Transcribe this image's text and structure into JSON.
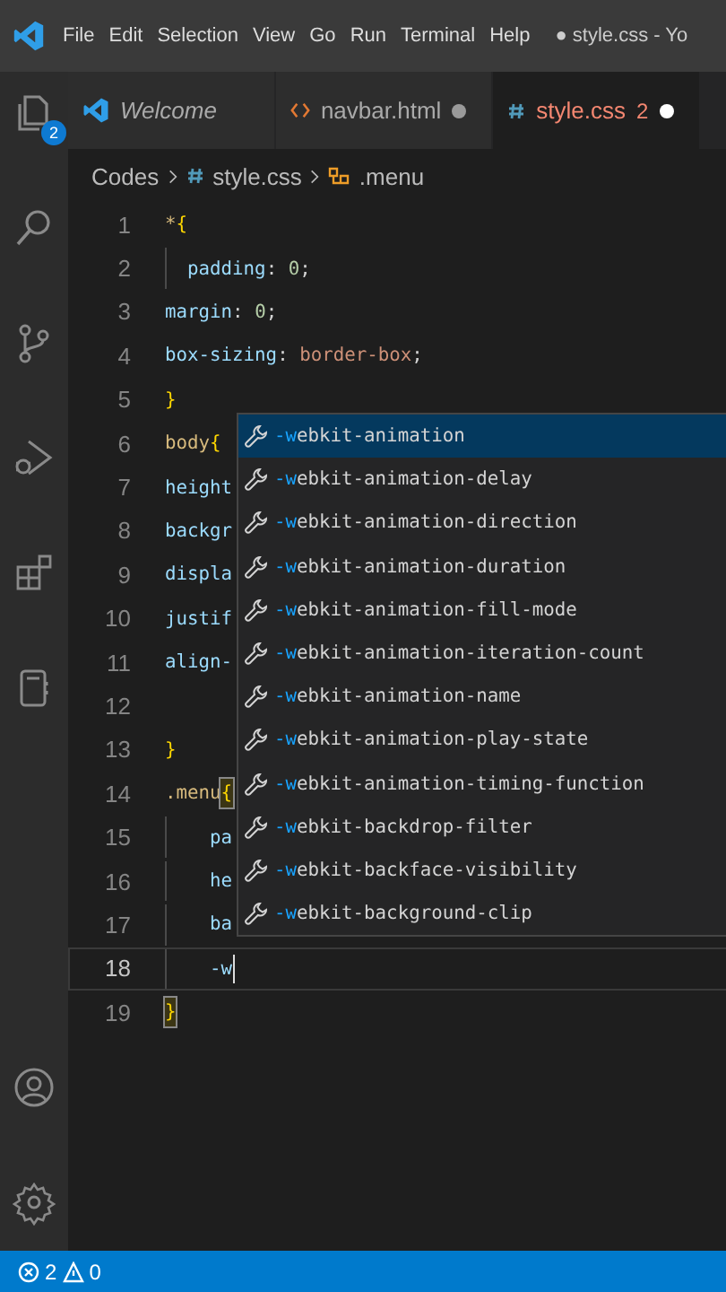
{
  "menu_bar": {
    "items": [
      "File",
      "Edit",
      "Selection",
      "View",
      "Go",
      "Run",
      "Terminal",
      "Help"
    ],
    "title": "● style.css - Yo"
  },
  "activity_bar": {
    "explorer_badge": "2"
  },
  "tabs": [
    {
      "label": "Welcome",
      "kind": "welcome",
      "selected": false,
      "dirty": false
    },
    {
      "label": "navbar.html",
      "kind": "html",
      "selected": false,
      "dirty": true
    },
    {
      "label": "style.css",
      "kind": "css",
      "selected": true,
      "problems": "2",
      "dirty": true
    }
  ],
  "breadcrumb": {
    "folder": "Codes",
    "file": "style.css",
    "symbol": ".menu"
  },
  "lines": [
    {
      "number": "1",
      "current": false,
      "tokens": [
        {
          "kind": "selector",
          "text": "*"
        },
        {
          "kind": "brace",
          "text": "{"
        }
      ]
    },
    {
      "number": "2",
      "current": false,
      "guide": true,
      "tokens": [
        {
          "kind": "property",
          "text": "  padding"
        },
        {
          "kind": "punct",
          "text": ": "
        },
        {
          "kind": "number",
          "text": "0"
        },
        {
          "kind": "punct",
          "text": ";"
        }
      ]
    },
    {
      "number": "3",
      "current": false,
      "tokens": [
        {
          "kind": "property",
          "text": "margin"
        },
        {
          "kind": "punct",
          "text": ": "
        },
        {
          "kind": "number",
          "text": "0"
        },
        {
          "kind": "punct",
          "text": ";"
        }
      ]
    },
    {
      "number": "4",
      "current": false,
      "tokens": [
        {
          "kind": "property",
          "text": "box-sizing"
        },
        {
          "kind": "punct",
          "text": ": "
        },
        {
          "kind": "string",
          "text": "border-box"
        },
        {
          "kind": "punct",
          "text": ";"
        }
      ]
    },
    {
      "number": "5",
      "current": false,
      "tokens": [
        {
          "kind": "brace",
          "text": "}"
        }
      ]
    },
    {
      "number": "6",
      "current": false,
      "tokens": [
        {
          "kind": "selector",
          "text": "body"
        },
        {
          "kind": "brace",
          "text": "{"
        }
      ]
    },
    {
      "number": "7",
      "current": false,
      "tokens": [
        {
          "kind": "property",
          "text": "height"
        }
      ]
    },
    {
      "number": "8",
      "current": false,
      "tokens": [
        {
          "kind": "property",
          "text": "backgr"
        }
      ]
    },
    {
      "number": "9",
      "current": false,
      "tokens": [
        {
          "kind": "property",
          "text": "displa"
        }
      ]
    },
    {
      "number": "10",
      "current": false,
      "tokens": [
        {
          "kind": "property",
          "text": "justif"
        }
      ]
    },
    {
      "number": "11",
      "current": false,
      "tokens": [
        {
          "kind": "property",
          "text": "align-"
        }
      ]
    },
    {
      "number": "12",
      "current": false
    },
    {
      "number": "13",
      "current": false,
      "tokens": [
        {
          "kind": "brace",
          "text": "}"
        }
      ]
    },
    {
      "number": "14",
      "current": false,
      "tokens": [
        {
          "kind": "selector",
          "text": ".menu"
        },
        {
          "kind": "brace-match",
          "text": "{"
        }
      ]
    },
    {
      "number": "15",
      "current": false,
      "guide": true,
      "tokens": [
        {
          "kind": "property",
          "text": "    pa"
        }
      ]
    },
    {
      "number": "16",
      "current": false,
      "guide": true,
      "tokens": [
        {
          "kind": "property",
          "text": "    he"
        }
      ]
    },
    {
      "number": "17",
      "current": false,
      "guide": true,
      "tokens": [
        {
          "kind": "property",
          "text": "    ba"
        }
      ]
    },
    {
      "number": "18",
      "current": true,
      "guide": true,
      "tokens": [
        {
          "kind": "property",
          "text": "    -w"
        }
      ]
    },
    {
      "number": "19",
      "current": false,
      "tokens": [
        {
          "kind": "brace-match",
          "text": "}"
        }
      ]
    }
  ],
  "suggestions": [
    {
      "match": "-w",
      "rest": "ebkit-animation",
      "selected": true
    },
    {
      "match": "-w",
      "rest": "ebkit-animation-delay",
      "selected": false
    },
    {
      "match": "-w",
      "rest": "ebkit-animation-direction",
      "selected": false
    },
    {
      "match": "-w",
      "rest": "ebkit-animation-duration",
      "selected": false
    },
    {
      "match": "-w",
      "rest": "ebkit-animation-fill-mode",
      "selected": false
    },
    {
      "match": "-w",
      "rest": "ebkit-animation-iteration-count",
      "selected": false
    },
    {
      "match": "-w",
      "rest": "ebkit-animation-name",
      "selected": false
    },
    {
      "match": "-w",
      "rest": "ebkit-animation-play-state",
      "selected": false
    },
    {
      "match": "-w",
      "rest": "ebkit-animation-timing-function",
      "selected": false
    },
    {
      "match": "-w",
      "rest": "ebkit-backdrop-filter",
      "selected": false
    },
    {
      "match": "-w",
      "rest": "ebkit-backface-visibility",
      "selected": false
    },
    {
      "match": "-w",
      "rest": "ebkit-background-clip",
      "selected": false
    }
  ],
  "status_bar": {
    "errors": "2",
    "warnings": "0"
  }
}
